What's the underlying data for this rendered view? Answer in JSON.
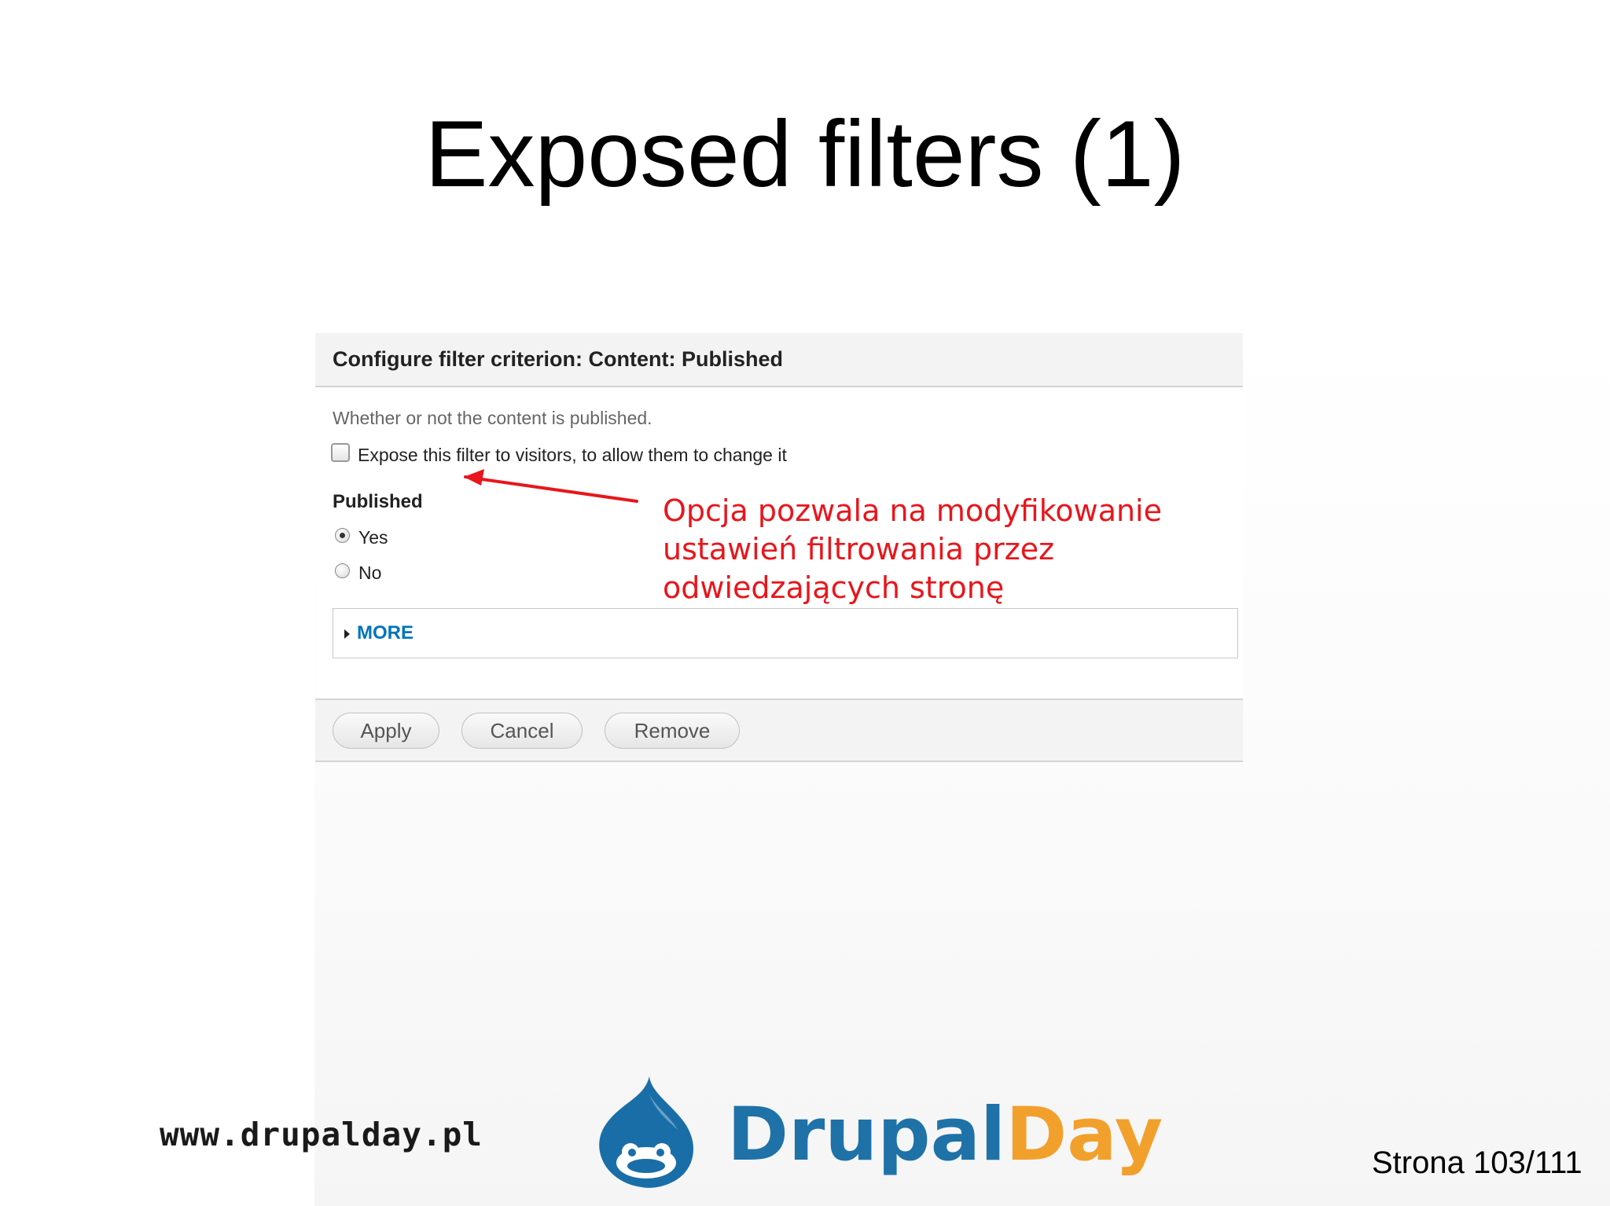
{
  "slide": {
    "title": "Exposed filters (1)"
  },
  "dialog": {
    "title": "Configure filter criterion: Content: Published",
    "description": "Whether or not the content is published.",
    "expose_checkbox": {
      "label": "Expose this filter to visitors, to allow them to change it",
      "checked": false
    },
    "published": {
      "label": "Published",
      "options": [
        {
          "label": "Yes",
          "selected": true
        },
        {
          "label": "No",
          "selected": false
        }
      ]
    },
    "more": {
      "label": "MORE",
      "expanded": false
    },
    "buttons": {
      "apply": "Apply",
      "cancel": "Cancel",
      "remove": "Remove"
    }
  },
  "annotation": {
    "lines": [
      "Opcja pozwala na modyfikowanie",
      "ustawień filtrowania przez",
      "odwiedzających stronę"
    ],
    "color": "#e8161c"
  },
  "footer": {
    "url": "www.drupalday.pl",
    "logo": {
      "part1": "Drupal",
      "part2": "Day",
      "color1": "#1f72a8",
      "color2": "#f2a02c"
    },
    "page": "Strona 103/111"
  },
  "colors": {
    "link": "#0074bd",
    "header_bg": "#f3f3f3"
  }
}
